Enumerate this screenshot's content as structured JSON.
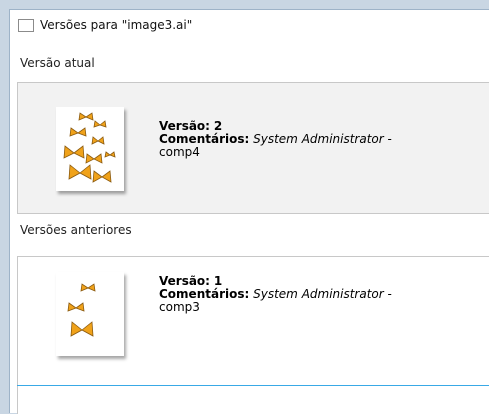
{
  "window": {
    "title": "Versões para \"image3.ai\""
  },
  "current": {
    "heading": "Versão atual",
    "version_label": "Versão:",
    "version_value": "2",
    "comments_label": "Comentários:",
    "author": "System Administrator",
    "dash": "-",
    "comment": "comp4"
  },
  "previous": {
    "heading": "Versões anteriores",
    "items": [
      {
        "version_label": "Versão:",
        "version_value": "1",
        "comments_label": "Comentários:",
        "author": "System Administrator",
        "dash": "-",
        "comment": "comp3"
      }
    ]
  },
  "colors": {
    "butterfly": "#f0a21a",
    "butterfly_dark": "#8a5a10",
    "selection": "#39a9e6"
  }
}
